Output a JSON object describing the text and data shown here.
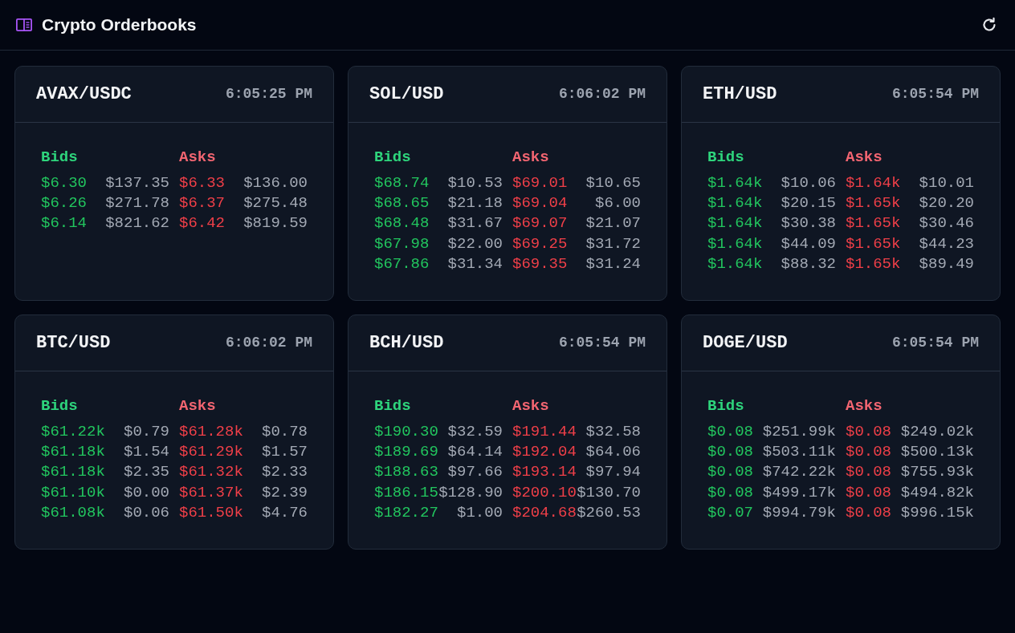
{
  "header": {
    "title": "Crypto Orderbooks"
  },
  "orderbooks": [
    {
      "pair": "AVAX/USDC",
      "time": "6:05:25 PM",
      "sides": [
        {
          "kind": "bids",
          "label": "Bids",
          "levels": [
            {
              "price": "$6.30",
              "size": "$137.35"
            },
            {
              "price": "$6.26",
              "size": "$271.78"
            },
            {
              "price": "$6.14",
              "size": "$821.62"
            }
          ]
        },
        {
          "kind": "asks",
          "label": "Asks",
          "levels": [
            {
              "price": "$6.33",
              "size": "$136.00"
            },
            {
              "price": "$6.37",
              "size": "$275.48"
            },
            {
              "price": "$6.42",
              "size": "$819.59"
            }
          ]
        }
      ]
    },
    {
      "pair": "SOL/USD",
      "time": "6:06:02 PM",
      "sides": [
        {
          "kind": "bids",
          "label": "Bids",
          "levels": [
            {
              "price": "$68.74",
              "size": "$10.53"
            },
            {
              "price": "$68.65",
              "size": "$21.18"
            },
            {
              "price": "$68.48",
              "size": "$31.67"
            },
            {
              "price": "$67.98",
              "size": "$22.00"
            },
            {
              "price": "$67.86",
              "size": "$31.34"
            }
          ]
        },
        {
          "kind": "asks",
          "label": "Asks",
          "levels": [
            {
              "price": "$69.01",
              "size": "$10.65"
            },
            {
              "price": "$69.04",
              "size": "$6.00"
            },
            {
              "price": "$69.07",
              "size": "$21.07"
            },
            {
              "price": "$69.25",
              "size": "$31.72"
            },
            {
              "price": "$69.35",
              "size": "$31.24"
            }
          ]
        }
      ]
    },
    {
      "pair": "ETH/USD",
      "time": "6:05:54 PM",
      "sides": [
        {
          "kind": "bids",
          "label": "Bids",
          "levels": [
            {
              "price": "$1.64k",
              "size": "$10.06"
            },
            {
              "price": "$1.64k",
              "size": "$20.15"
            },
            {
              "price": "$1.64k",
              "size": "$30.38"
            },
            {
              "price": "$1.64k",
              "size": "$44.09"
            },
            {
              "price": "$1.64k",
              "size": "$88.32"
            }
          ]
        },
        {
          "kind": "asks",
          "label": "Asks",
          "levels": [
            {
              "price": "$1.64k",
              "size": "$10.01"
            },
            {
              "price": "$1.65k",
              "size": "$20.20"
            },
            {
              "price": "$1.65k",
              "size": "$30.46"
            },
            {
              "price": "$1.65k",
              "size": "$44.23"
            },
            {
              "price": "$1.65k",
              "size": "$89.49"
            }
          ]
        }
      ]
    },
    {
      "pair": "BTC/USD",
      "time": "6:06:02 PM",
      "sides": [
        {
          "kind": "bids",
          "label": "Bids",
          "levels": [
            {
              "price": "$61.22k",
              "size": "$0.79"
            },
            {
              "price": "$61.18k",
              "size": "$1.54"
            },
            {
              "price": "$61.18k",
              "size": "$2.35"
            },
            {
              "price": "$61.10k",
              "size": "$0.00"
            },
            {
              "price": "$61.08k",
              "size": "$0.06"
            }
          ]
        },
        {
          "kind": "asks",
          "label": "Asks",
          "levels": [
            {
              "price": "$61.28k",
              "size": "$0.78"
            },
            {
              "price": "$61.29k",
              "size": "$1.57"
            },
            {
              "price": "$61.32k",
              "size": "$2.33"
            },
            {
              "price": "$61.37k",
              "size": "$2.39"
            },
            {
              "price": "$61.50k",
              "size": "$4.76"
            }
          ]
        }
      ]
    },
    {
      "pair": "BCH/USD",
      "time": "6:05:54 PM",
      "sides": [
        {
          "kind": "bids",
          "label": "Bids",
          "levels": [
            {
              "price": "$190.30",
              "size": "$32.59"
            },
            {
              "price": "$189.69",
              "size": "$64.14"
            },
            {
              "price": "$188.63",
              "size": "$97.66"
            },
            {
              "price": "$186.15",
              "size": "$128.90"
            },
            {
              "price": "$182.27",
              "size": "$1.00"
            }
          ]
        },
        {
          "kind": "asks",
          "label": "Asks",
          "levels": [
            {
              "price": "$191.44",
              "size": "$32.58"
            },
            {
              "price": "$192.04",
              "size": "$64.06"
            },
            {
              "price": "$193.14",
              "size": "$97.94"
            },
            {
              "price": "$200.10",
              "size": "$130.70"
            },
            {
              "price": "$204.68",
              "size": "$260.53"
            }
          ]
        }
      ]
    },
    {
      "pair": "DOGE/USD",
      "time": "6:05:54 PM",
      "sides": [
        {
          "kind": "bids",
          "label": "Bids",
          "levels": [
            {
              "price": "$0.08",
              "size": "$251.99k"
            },
            {
              "price": "$0.08",
              "size": "$503.11k"
            },
            {
              "price": "$0.08",
              "size": "$742.22k"
            },
            {
              "price": "$0.08",
              "size": "$499.17k"
            },
            {
              "price": "$0.07",
              "size": "$994.79k"
            }
          ]
        },
        {
          "kind": "asks",
          "label": "Asks",
          "levels": [
            {
              "price": "$0.08",
              "size": "$249.02k"
            },
            {
              "price": "$0.08",
              "size": "$500.13k"
            },
            {
              "price": "$0.08",
              "size": "$755.93k"
            },
            {
              "price": "$0.08",
              "size": "$494.82k"
            },
            {
              "price": "$0.08",
              "size": "$996.15k"
            }
          ]
        }
      ]
    }
  ]
}
